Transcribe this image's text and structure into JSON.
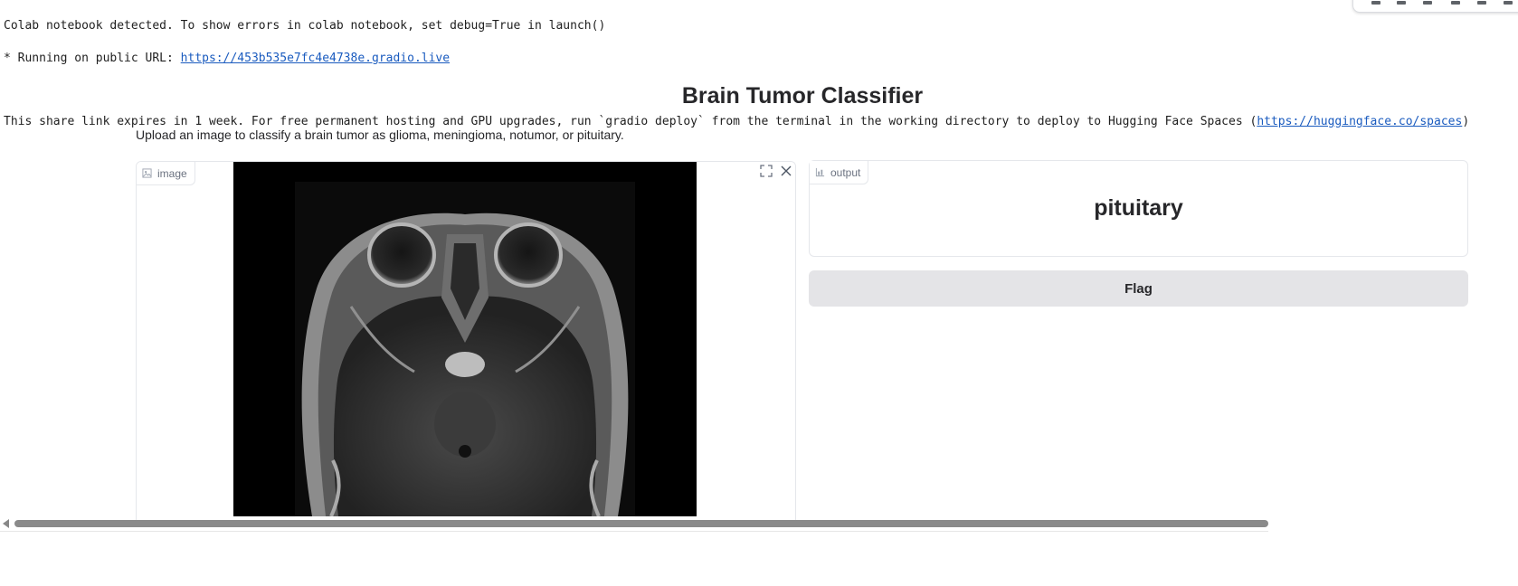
{
  "console": {
    "line1": "Colab notebook detected. To show errors in colab notebook, set debug=True in launch()",
    "line2_prefix": "* Running on public URL: ",
    "public_url": "https://453b535e7fc4e4738e.gradio.live",
    "line3_prefix": "This share link expires in 1 week. For free permanent hosting and GPU upgrades, run `gradio deploy` from the terminal in the working directory to deploy to Hugging Face Spaces (",
    "spaces_url": "https://huggingface.co/spaces",
    "line3_suffix": ")"
  },
  "app": {
    "title": "Brain Tumor Classifier",
    "description": "Upload an image to classify a brain tumor as glioma, meningioma, notumor, or pituitary."
  },
  "image_input": {
    "label": "image",
    "label_icon": "image-icon",
    "actions": [
      {
        "icon": "fullscreen-icon"
      },
      {
        "icon": "close-icon"
      }
    ]
  },
  "output": {
    "label": "output",
    "label_icon": "chart-icon",
    "value": "pituitary"
  },
  "flag_button": {
    "label": "Flag"
  },
  "colors": {
    "link": "#1a5bbf",
    "panel_border": "#e5e7eb",
    "button_bg": "#e4e4e7",
    "text": "#27272a",
    "muted": "#6b7280"
  }
}
